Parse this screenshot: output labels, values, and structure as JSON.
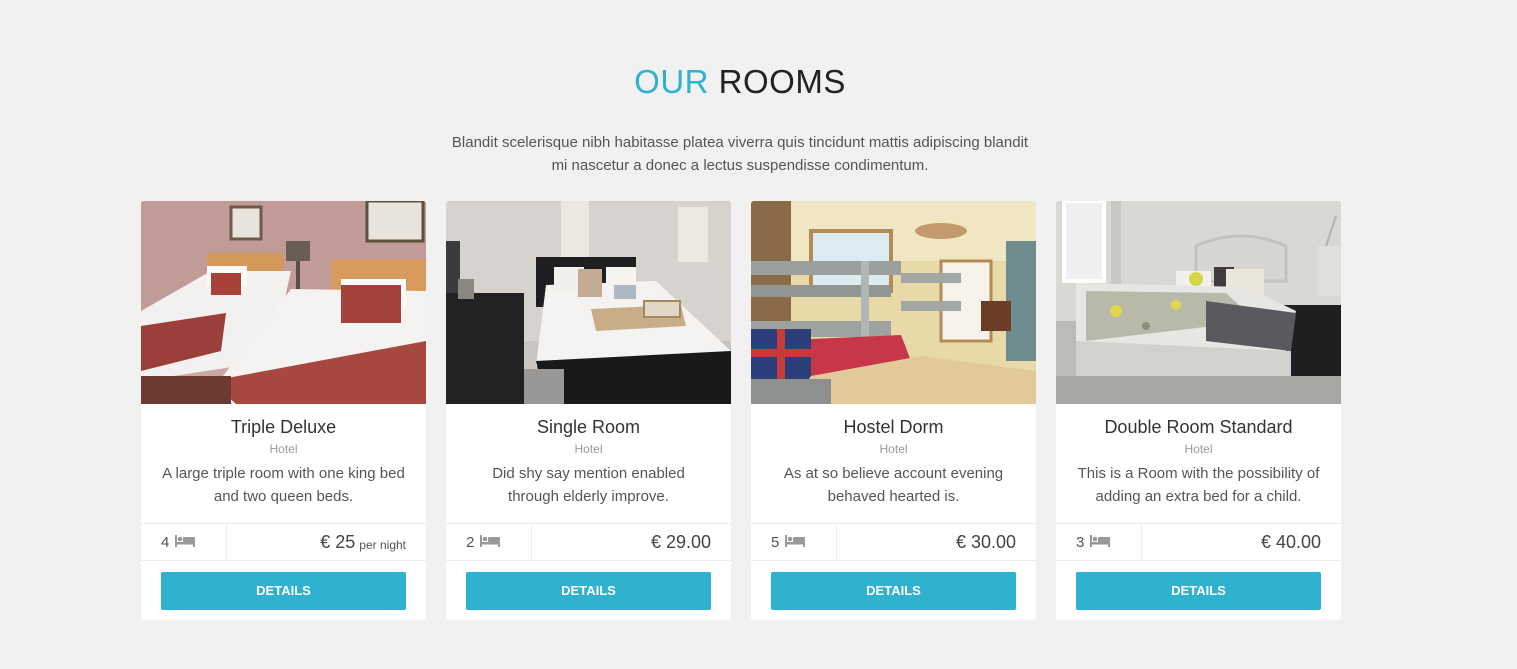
{
  "section": {
    "title_accent": "OUR",
    "title_rest": "ROOMS",
    "intro_line1": "Blandit scelerisque nibh habitasse platea viverra quis tincidunt mattis adipiscing blandit",
    "intro_line2": "mi nascetur a donec a lectus suspendisse condimentum."
  },
  "colors": {
    "accent": "#2fb1cf",
    "background": "#f1f1f1",
    "card": "#ffffff"
  },
  "rooms": [
    {
      "title": "Triple Deluxe",
      "type": "Hotel",
      "description": "A large triple room with one king bed and two queen beds.",
      "beds": "4",
      "bed_icon": "bed-icon",
      "price": "€ 25",
      "price_unit": "per night",
      "button": "DETAILS"
    },
    {
      "title": "Single Room",
      "type": "Hotel",
      "description": "Did shy say mention enabled through elderly improve.",
      "beds": "2",
      "bed_icon": "bed-icon",
      "price": "€ 29.00",
      "price_unit": "",
      "button": "DETAILS"
    },
    {
      "title": "Hostel Dorm",
      "type": "Hotel",
      "description": "As at so believe account evening behaved hearted is.",
      "beds": "5",
      "bed_icon": "bed-icon",
      "price": "€ 30.00",
      "price_unit": "",
      "button": "DETAILS"
    },
    {
      "title": "Double Room Standard",
      "type": "Hotel",
      "description": "This is a Room with the possibility of adding an extra bed for a child.",
      "beds": "3",
      "bed_icon": "bed-icon",
      "price": "€ 40.00",
      "price_unit": "",
      "button": "DETAILS"
    }
  ]
}
